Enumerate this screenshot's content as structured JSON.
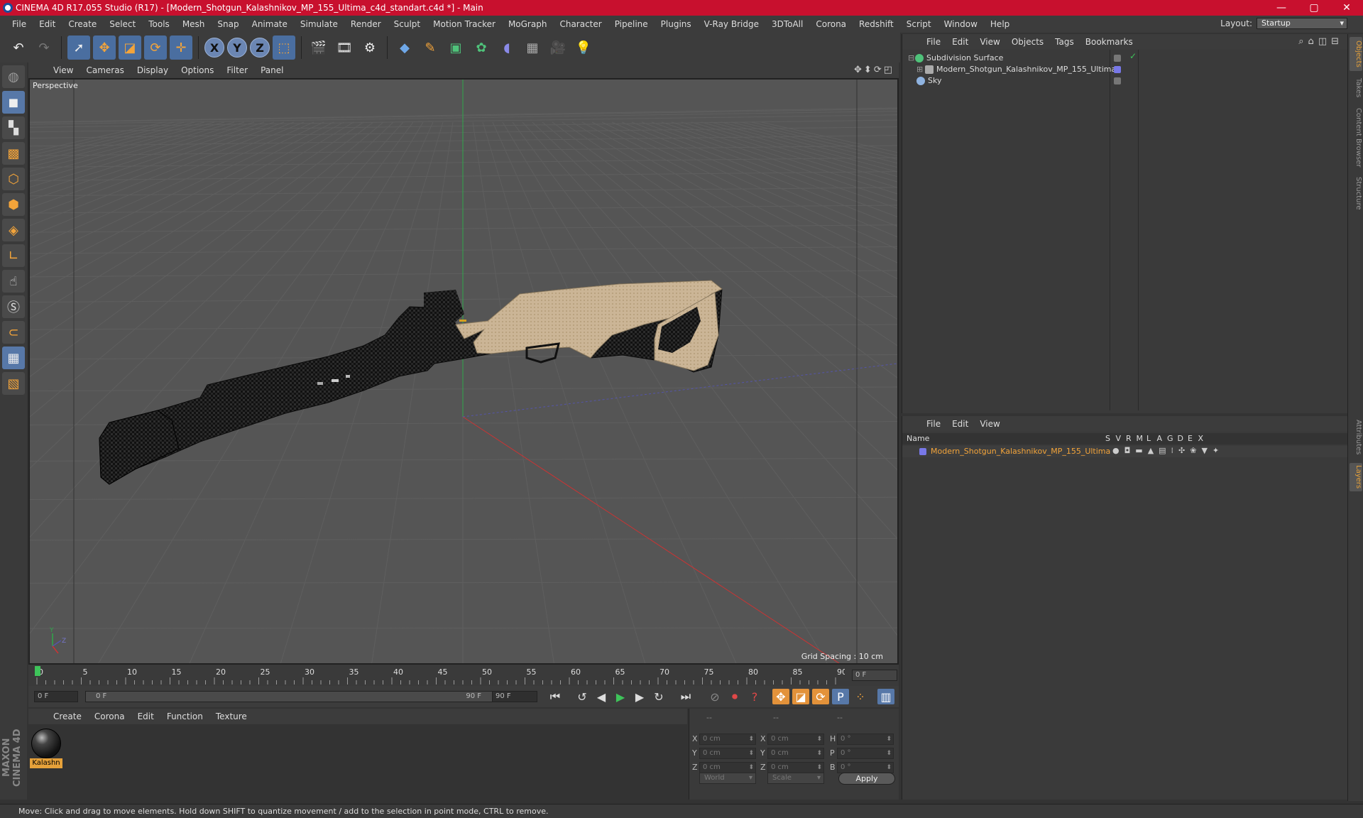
{
  "window": {
    "title": "CINEMA 4D R17.055 Studio (R17) - [Modern_Shotgun_Kalashnikov_MP_155_Ultima_c4d_standart.c4d *] - Main",
    "controls": [
      "—",
      "▢",
      "✕"
    ]
  },
  "menubar": {
    "items": [
      "File",
      "Edit",
      "Create",
      "Select",
      "Tools",
      "Mesh",
      "Snap",
      "Animate",
      "Simulate",
      "Render",
      "Sculpt",
      "Motion Tracker",
      "MoGraph",
      "Character",
      "Pipeline",
      "Plugins",
      "V-Ray Bridge",
      "3DToAll",
      "Corona",
      "Redshift",
      "Script",
      "Window",
      "Help"
    ],
    "layout_label": "Layout:",
    "layout_value": "Startup"
  },
  "viewport": {
    "menu": [
      "View",
      "Cameras",
      "Display",
      "Options",
      "Filter",
      "Panel"
    ],
    "camera_label": "Perspective",
    "grid_spacing": "Grid Spacing : 10 cm"
  },
  "timeline": {
    "ticks": [
      "0",
      "5",
      "10",
      "15",
      "20",
      "25",
      "30",
      "35",
      "40",
      "45",
      "50",
      "55",
      "60",
      "65",
      "70",
      "75",
      "80",
      "85",
      "90"
    ],
    "current_frame_box": "0 F"
  },
  "transport": {
    "start_field": "0 F",
    "slider_start": "0 F",
    "slider_end": "90 F",
    "end_field": "90 F"
  },
  "material_manager": {
    "menu": [
      "Create",
      "Corona",
      "Edit",
      "Function",
      "Texture"
    ],
    "material_name": "Kalashn"
  },
  "coordinates": {
    "headers": [
      "--",
      "--",
      "--"
    ],
    "rows": [
      {
        "a": "X",
        "av": "0 cm",
        "b": "X",
        "bv": "0 cm",
        "c": "H",
        "cv": "0 °"
      },
      {
        "a": "Y",
        "av": "0 cm",
        "b": "Y",
        "bv": "0 cm",
        "c": "P",
        "cv": "0 °"
      },
      {
        "a": "Z",
        "av": "0 cm",
        "b": "Z",
        "bv": "0 cm",
        "c": "B",
        "cv": "0 °"
      }
    ],
    "space_select": "World",
    "mode_select": "Scale",
    "apply_label": "Apply"
  },
  "object_manager": {
    "menu": [
      "File",
      "Edit",
      "View",
      "Objects",
      "Tags",
      "Bookmarks"
    ],
    "objects": [
      {
        "name": "Subdivision Surface",
        "icon_color": "#4fc27a"
      },
      {
        "name": "Modern_Shotgun_Kalashnikov_MP_155_Ultima",
        "icon_color": "#aaaaaa"
      },
      {
        "name": "Sky",
        "icon_color": "#8fb3e0"
      }
    ]
  },
  "layer_manager": {
    "menu": [
      "File",
      "Edit",
      "View"
    ],
    "columns": [
      "Name",
      "S",
      "V",
      "R",
      "M",
      "L",
      "A",
      "G",
      "D",
      "E",
      "X"
    ],
    "layer_name": "Modern_Shotgun_Kalashnikov_MP_155_Ultima"
  },
  "side_tabs": [
    "Objects",
    "Takes",
    "Content Browser",
    "Structure",
    "Attributes",
    "Layers"
  ],
  "status": {
    "text": "Move: Click and drag to move elements. Hold down SHIFT to quantize movement / add to the selection in point mode, CTRL to remove."
  },
  "branding": {
    "logo_text": "MAXON CINEMA 4D"
  },
  "colors": {
    "titlebar": "#c8102e",
    "accent": "#e6a13a",
    "selected_blue": "#5778a8"
  }
}
